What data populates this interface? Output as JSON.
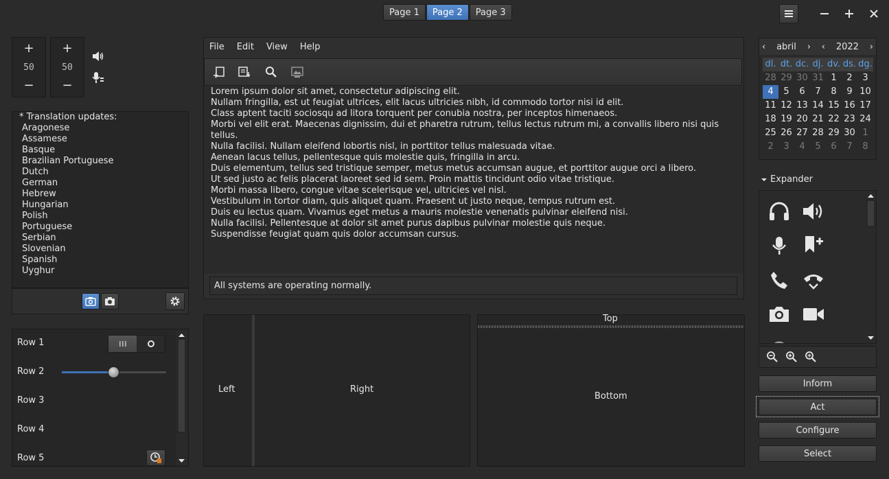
{
  "header": {
    "tabs": [
      {
        "label": "Page 1",
        "active": false
      },
      {
        "label": "Page 2",
        "active": true
      },
      {
        "label": "Page 3",
        "active": false
      }
    ]
  },
  "spinners": [
    {
      "plus": "+",
      "minus": "−",
      "value": "50"
    },
    {
      "plus": "+",
      "minus": "−",
      "value": "50"
    }
  ],
  "languages": {
    "header": "* Translation updates:",
    "items": [
      "Aragonese",
      "Assamese",
      "Basque",
      "Brazilian Portuguese",
      "Dutch",
      "German",
      "Hebrew",
      "Hungarian",
      "Polish",
      "Portuguese",
      "Serbian",
      "Slovenian",
      "Spanish",
      "Uyghur"
    ]
  },
  "rows": {
    "labels": [
      "Row 1",
      "Row 2",
      "Row 3",
      "Row 4",
      "Row 5"
    ],
    "row1_toggle": {
      "on_glyph": "III",
      "off_glyph": "O"
    },
    "row2_slider": 0.5
  },
  "menubar": [
    "File",
    "Edit",
    "View",
    "Help"
  ],
  "text_lines": [
    "Lorem ipsum dolor sit amet, consectetur adipiscing elit.",
    "Nullam fringilla, est ut feugiat ultrices, elit lacus ultricies nibh, id commodo tortor nisi id elit.",
    "Class aptent taciti sociosqu ad litora torquent per conubia nostra, per inceptos himenaeos.",
    "Morbi vel elit erat. Maecenas dignissim, dui et pharetra rutrum, tellus lectus rutrum mi, a convallis libero nisi quis",
    "tellus.",
    "Nulla facilisi. Nullam eleifend lobortis nisl, in porttitor tellus malesuada vitae.",
    "Aenean lacus tellus, pellentesque quis molestie quis, fringilla in arcu.",
    "Duis elementum, tellus sed tristique semper, metus metus accumsan augue, et porttitor augue orci a libero.",
    "Ut sed justo ac felis placerat laoreet sed id sem. Proin mattis tincidunt odio vitae tristique.",
    "Morbi massa libero, congue vitae scelerisque vel, ultricies vel nisl.",
    "Vestibulum in tortor diam, quis aliquet quam. Praesent ut justo neque, tempus rutrum est.",
    "Duis eu lectus quam. Vivamus eget metus a mauris molestie venenatis pulvinar eleifend nisi.",
    "Nulla facilisi. Pellentesque at dolor sit amet purus dapibus pulvinar molestie quis neque.",
    "Suspendisse feugiat quam quis dolor accumsan cursus."
  ],
  "status": "All systems are operating normally.",
  "panes": {
    "left": "Left",
    "right": "Right",
    "top": "Top",
    "bottom": "Bottom"
  },
  "calendar": {
    "month": "abril",
    "year": "2022",
    "prev": "‹",
    "next": "›",
    "dows": [
      "dl.",
      "dt.",
      "dc.",
      "dj.",
      "dv.",
      "ds.",
      "dg."
    ],
    "weeks": [
      [
        [
          "28",
          true
        ],
        [
          "29",
          true
        ],
        [
          "30",
          true
        ],
        [
          "31",
          true
        ],
        [
          "1",
          false
        ],
        [
          "2",
          false
        ],
        [
          "3",
          false
        ]
      ],
      [
        [
          "4",
          false
        ],
        [
          "5",
          false
        ],
        [
          "6",
          false
        ],
        [
          "7",
          false
        ],
        [
          "8",
          false
        ],
        [
          "9",
          false
        ],
        [
          "10",
          false
        ]
      ],
      [
        [
          "11",
          false
        ],
        [
          "12",
          false
        ],
        [
          "13",
          false
        ],
        [
          "14",
          false
        ],
        [
          "15",
          false
        ],
        [
          "16",
          false
        ],
        [
          "17",
          false
        ]
      ],
      [
        [
          "18",
          false
        ],
        [
          "19",
          false
        ],
        [
          "20",
          false
        ],
        [
          "21",
          false
        ],
        [
          "22",
          false
        ],
        [
          "23",
          false
        ],
        [
          "24",
          false
        ]
      ],
      [
        [
          "25",
          false
        ],
        [
          "26",
          false
        ],
        [
          "27",
          false
        ],
        [
          "28",
          false
        ],
        [
          "29",
          false
        ],
        [
          "30",
          false
        ],
        [
          "1",
          true
        ]
      ],
      [
        [
          "2",
          true
        ],
        [
          "3",
          true
        ],
        [
          "4",
          true
        ],
        [
          "5",
          true
        ],
        [
          "6",
          true
        ],
        [
          "7",
          true
        ],
        [
          "8",
          true
        ]
      ]
    ],
    "selected_day": "4"
  },
  "expander": {
    "label": "Expander"
  },
  "actions": [
    "Inform",
    "Act",
    "Configure",
    "Select"
  ],
  "colors": {
    "accent": "#3f72b8",
    "dow": "#5ea1e8",
    "bg": "#2b2b2b"
  }
}
